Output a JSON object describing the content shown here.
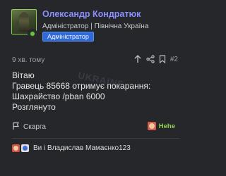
{
  "post": {
    "author": "Олександр Кондратюк",
    "role": "Адміністратор",
    "location": "Північна Україна",
    "separator": "|",
    "badge": "Адміністратор",
    "time": "9 хв. тому",
    "post_number": "#2",
    "message_lines": [
      "Вітаю",
      "Гравець 85668 отримує покарання:",
      "Шахрайство /pban 6000",
      "Розглянуто"
    ],
    "watermark": "UKRAINE",
    "report_label": "Скарга",
    "reaction_label": "Hehe",
    "reactors_text": "Ви і Владислав Мамаєнко123"
  },
  "colors": {
    "author": "#8b8dff",
    "badge_bg": "#2f6ad6",
    "reaction_label": "#8fd14f",
    "background": "#25272a"
  },
  "icons": {
    "online_status": "online-dot",
    "up_arrow": "arrow-up-icon",
    "share": "share-icon",
    "bookmark": "bookmark-icon",
    "report": "flag-icon",
    "reaction": "hehe-reaction-icon"
  }
}
